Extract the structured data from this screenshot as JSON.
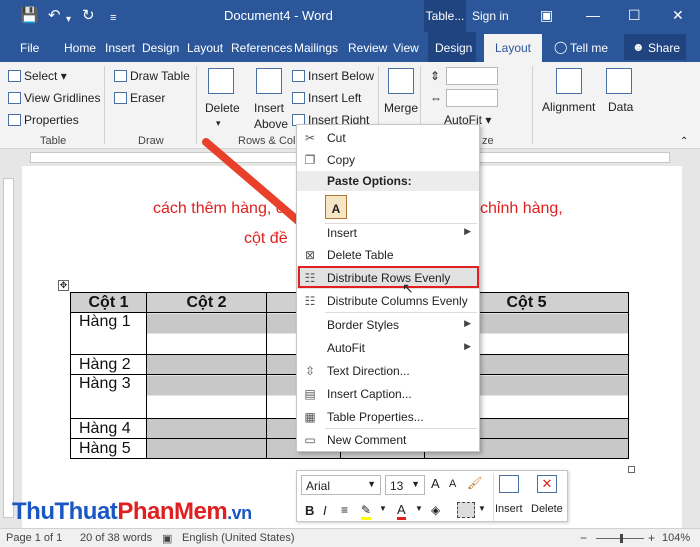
{
  "titlebar": {
    "title": "Document4 - Word",
    "table_tools": "Table...",
    "signin": "Sign in",
    "quick_access": [
      "save-icon",
      "undo-icon",
      "redo-icon",
      "customize-icon"
    ],
    "window_controls": [
      "ribbon-display-icon",
      "minimize-icon",
      "maximize-icon",
      "close-icon"
    ]
  },
  "tabs": [
    "File",
    "Home",
    "Insert",
    "Design",
    "Layout",
    "References",
    "Mailings",
    "Review",
    "View",
    "Design",
    "Layout"
  ],
  "tell_me": "Tell me",
  "share": "Share",
  "ribbon": {
    "table_group": {
      "label": "Table",
      "items": [
        "Select",
        "View Gridlines",
        "Properties"
      ]
    },
    "draw_group": {
      "label": "Draw",
      "items": [
        "Draw Table",
        "Eraser"
      ]
    },
    "rows_cols_group": {
      "label": "Rows & Col",
      "delete": "Delete",
      "insert_above_1": "Insert",
      "insert_above_2": "Above",
      "items": [
        "Insert Below",
        "Insert Left",
        "Insert Right"
      ]
    },
    "merge": "Merge",
    "autofit": "AutoFit",
    "size_suffix": "ze",
    "alignment": "Alignment",
    "data": "Data"
  },
  "document": {
    "red_text_1a": "cách thêm hàng, c",
    "red_text_1b": "chỉnh hàng,",
    "red_text_2": "cột đề",
    "table": {
      "headers": [
        "Cột 1",
        "Cột 2",
        "C",
        "",
        "Cột 5"
      ],
      "rows": [
        "Hàng 1",
        "Hàng 2",
        "Hàng 3",
        "Hàng 4",
        "Hàng 5"
      ]
    }
  },
  "context_menu": {
    "cut": "Cut",
    "copy": "Copy",
    "paste_options": "Paste Options:",
    "insert": "Insert",
    "delete_table": "Delete Table",
    "distribute_rows": "Distribute Rows Evenly",
    "distribute_columns": "Distribute Columns Evenly",
    "border_styles": "Border Styles",
    "autofit": "AutoFit",
    "text_direction": "Text Direction...",
    "insert_caption": "Insert Caption...",
    "table_properties": "Table Properties...",
    "new_comment": "New Comment"
  },
  "mini_toolbar": {
    "font": "Arial",
    "size": "13",
    "bold": "B",
    "italic": "I",
    "insert": "Insert",
    "delete": "Delete"
  },
  "statusbar": {
    "page": "Page 1 of 1",
    "words": "20 of 38 words",
    "language": "English (United States)",
    "zoom": "104%"
  },
  "watermark": {
    "part1": "ThuThuat",
    "part2": "PhanMem",
    "part3": ".vn"
  },
  "colors": {
    "word_blue": "#2b579a",
    "highlight_red": "#e02020",
    "watermark_blue": "#1a56c4",
    "watermark_red": "#e02020"
  }
}
